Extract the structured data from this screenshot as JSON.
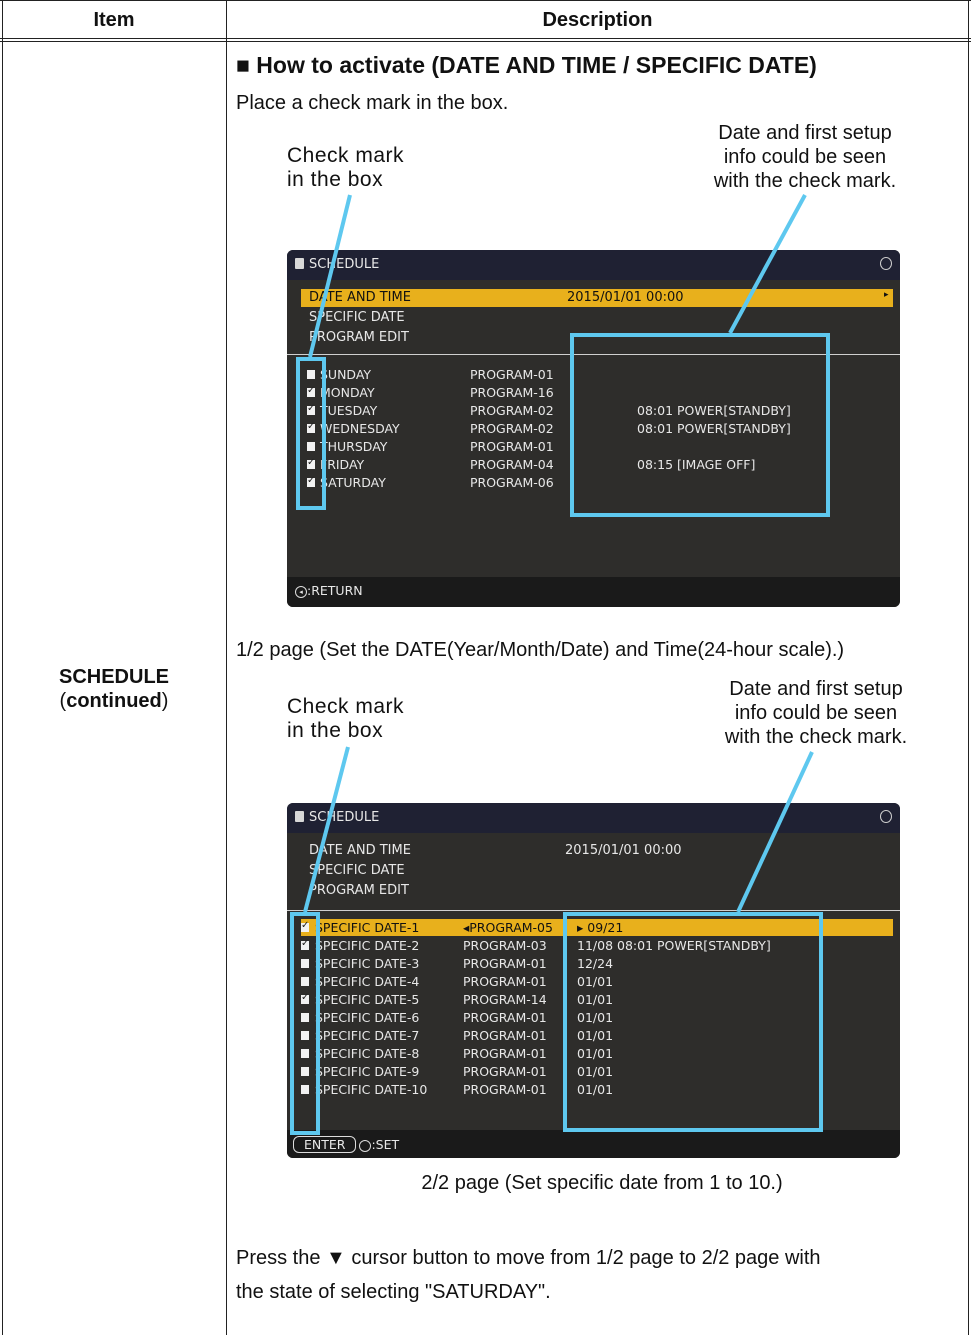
{
  "table": {
    "header_item": "Item",
    "header_description": "Description",
    "item_title": "SCHEDULE",
    "item_paren_open": "(",
    "item_subtitle": "continued",
    "item_paren_close": ")"
  },
  "section": {
    "heading": "■ How to activate (DATE AND TIME / SPECIFIC DATE)",
    "intro": "Place a check mark in the box."
  },
  "callouts": {
    "check_mark_line1": "Check mark",
    "check_mark_line2": "in the box",
    "info_line1": "Date and first setup",
    "info_line2": "info could be seen",
    "info_line3": "with the check mark."
  },
  "screen1": {
    "title": "SCHEDULE",
    "menu": [
      {
        "label": "DATE AND TIME",
        "value": "2015/01/01 00:00"
      },
      {
        "label": "SPECIFIC DATE"
      },
      {
        "label": "PROGRAM EDIT"
      }
    ],
    "rows": [
      {
        "day": "SUNDAY",
        "program": "PROGRAM-01",
        "info": "",
        "checked": false
      },
      {
        "day": "MONDAY",
        "program": "PROGRAM-16",
        "info": "",
        "checked": true
      },
      {
        "day": "TUESDAY",
        "program": "PROGRAM-02",
        "info": "08:01 POWER[STANDBY]",
        "checked": true
      },
      {
        "day": "WEDNESDAY",
        "program": "PROGRAM-02",
        "info": "08:01 POWER[STANDBY]",
        "checked": true
      },
      {
        "day": "THURSDAY",
        "program": "PROGRAM-01",
        "info": "",
        "checked": false
      },
      {
        "day": "FRIDAY",
        "program": "PROGRAM-04",
        "info": "08:15 [IMAGE OFF]",
        "checked": true
      },
      {
        "day": "SATURDAY",
        "program": "PROGRAM-06",
        "info": "",
        "checked": true
      }
    ],
    "footer": ":RETURN"
  },
  "caption1": "1/2 page (Set the DATE(Year/Month/Date) and Time(24-hour scale).)",
  "screen2": {
    "title": "SCHEDULE",
    "menu": [
      {
        "label": "DATE AND TIME",
        "value": "2015/01/01 00:00"
      },
      {
        "label": "SPECIFIC DATE"
      },
      {
        "label": "PROGRAM EDIT"
      }
    ],
    "rows": [
      {
        "name": "SPECIFIC DATE-1",
        "program": "◂PROGRAM-05",
        "info": "▸ 09/21",
        "checked": true
      },
      {
        "name": "SPECIFIC DATE-2",
        "program": "PROGRAM-03",
        "info": "11/08 08:01 POWER[STANDBY]",
        "checked": true
      },
      {
        "name": "SPECIFIC DATE-3",
        "program": "PROGRAM-01",
        "info": "12/24",
        "checked": false
      },
      {
        "name": "SPECIFIC DATE-4",
        "program": "PROGRAM-01",
        "info": "01/01",
        "checked": false
      },
      {
        "name": "SPECIFIC DATE-5",
        "program": "PROGRAM-14",
        "info": "01/01",
        "checked": true
      },
      {
        "name": "SPECIFIC DATE-6",
        "program": "PROGRAM-01",
        "info": "01/01",
        "checked": false
      },
      {
        "name": "SPECIFIC DATE-7",
        "program": "PROGRAM-01",
        "info": "01/01",
        "checked": false
      },
      {
        "name": "SPECIFIC DATE-8",
        "program": "PROGRAM-01",
        "info": "01/01",
        "checked": false
      },
      {
        "name": "SPECIFIC DATE-9",
        "program": "PROGRAM-01",
        "info": "01/01",
        "checked": false
      },
      {
        "name": "SPECIFIC DATE-10",
        "program": "PROGRAM-01",
        "info": "01/01",
        "checked": false
      }
    ],
    "footer_enter": "ENTER",
    "footer_set": ":SET"
  },
  "caption2": "2/2 page (Set specific date from 1 to 10.)",
  "note_line1": "Press the ▼ cursor button to move from 1/2 page to 2/2 page with",
  "note_line2": "the state of selecting \"SATURDAY\".",
  "colors": {
    "highlight": "#e8b01c",
    "callout_box": "#5ec8ef",
    "osd_bg": "#2e2d2b"
  }
}
